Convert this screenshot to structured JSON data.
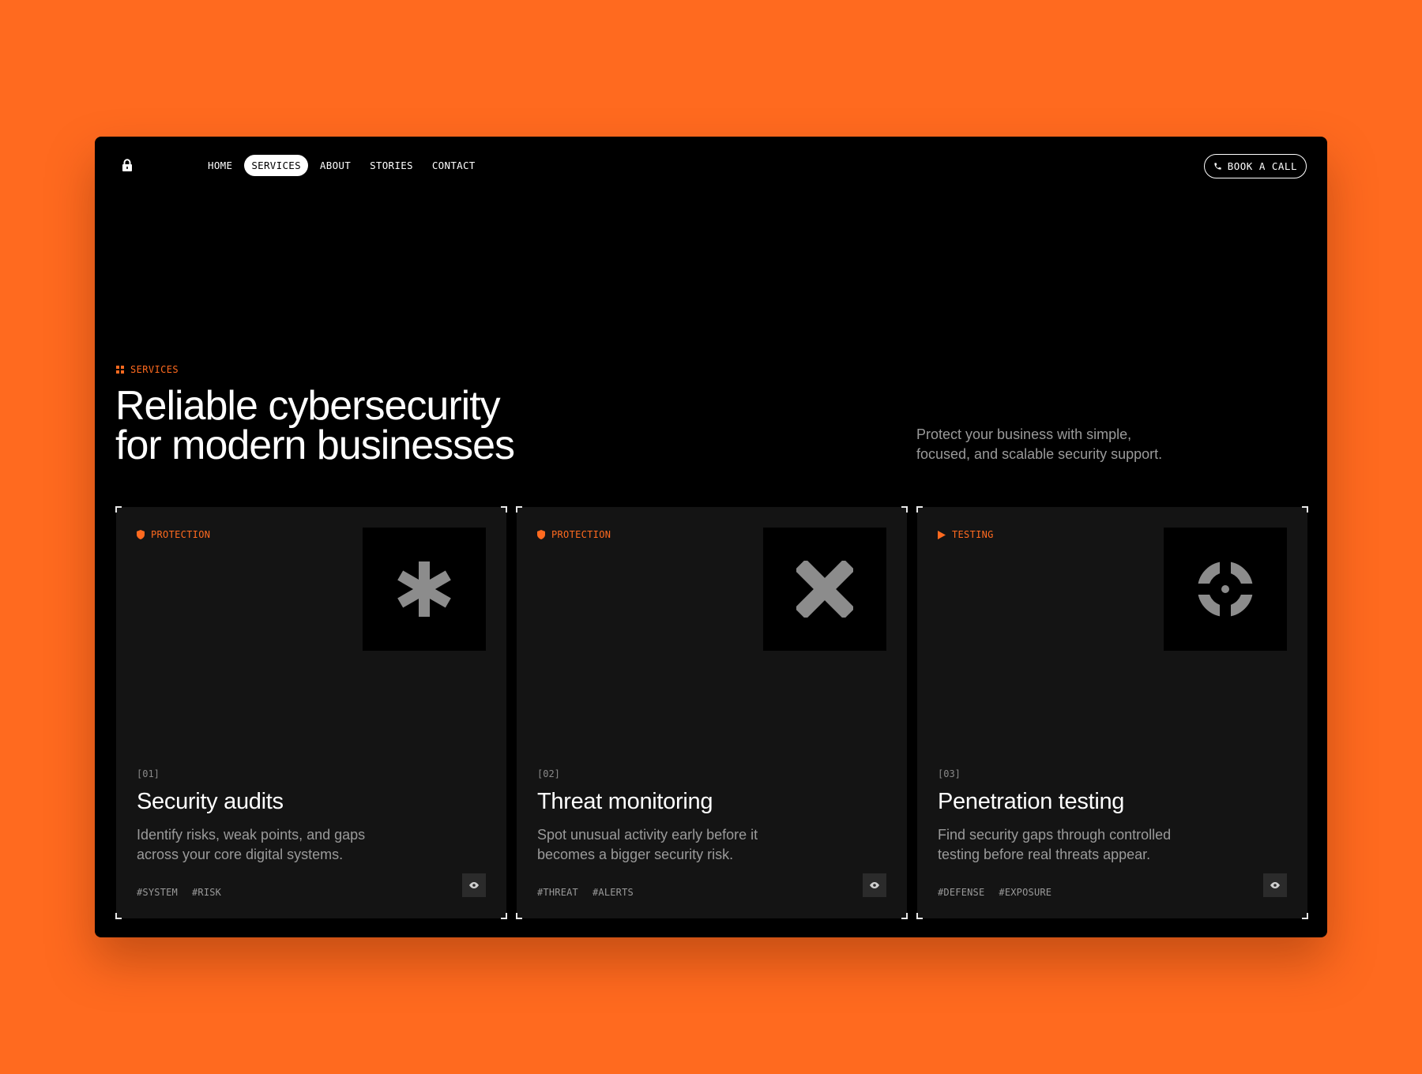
{
  "nav": {
    "logo_icon": "lock-icon",
    "links": [
      {
        "label": "HOME",
        "active": false
      },
      {
        "label": "SERVICES",
        "active": true
      },
      {
        "label": "ABOUT",
        "active": false
      },
      {
        "label": "STORIES",
        "active": false
      },
      {
        "label": "CONTACT",
        "active": false
      }
    ],
    "cta": {
      "label": "BOOK A CALL",
      "icon": "phone-icon"
    }
  },
  "hero": {
    "eyebrow": "SERVICES",
    "eyebrow_icon": "grid-icon",
    "headline_line1": "Reliable cybersecurity",
    "headline_line2": "for modern businesses",
    "subcopy_line1": "Protect your business with simple,",
    "subcopy_line2": "focused, and scalable security support."
  },
  "colors": {
    "background": "#ff6a1f",
    "accent": "#ff6a1f",
    "window": "#000000",
    "card": "#141414",
    "muted_text": "#9a9a9a"
  },
  "cards": [
    {
      "tag": "PROTECTION",
      "tag_icon": "shield-icon",
      "tile_icon": "asterisk-icon",
      "number": "[01]",
      "title": "Security audits",
      "desc_line1": "Identify risks, weak points, and gaps",
      "desc_line2": "across your core digital systems.",
      "hashtags": [
        "#SYSTEM",
        "#RISK"
      ],
      "action_icon": "eye-icon"
    },
    {
      "tag": "PROTECTION",
      "tag_icon": "shield-icon",
      "tile_icon": "x-mark-icon",
      "number": "[02]",
      "title": "Threat monitoring",
      "desc_line1": "Spot unusual activity early before it",
      "desc_line2": "becomes a bigger security risk.",
      "hashtags": [
        "#THREAT",
        "#ALERTS"
      ],
      "action_icon": "eye-icon"
    },
    {
      "tag": "TESTING",
      "tag_icon": "play-icon",
      "tile_icon": "crosshair-icon",
      "number": "[03]",
      "title": "Penetration testing",
      "desc_line1": "Find security gaps through controlled",
      "desc_line2": "testing before real threats appear.",
      "hashtags": [
        "#DEFENSE",
        "#EXPOSURE"
      ],
      "action_icon": "eye-icon"
    }
  ]
}
